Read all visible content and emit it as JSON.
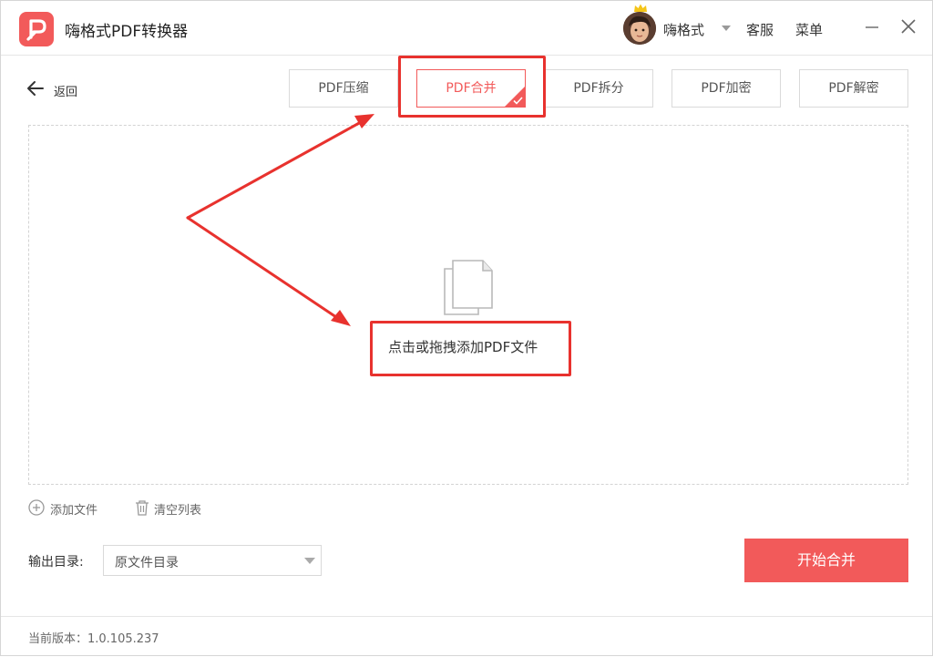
{
  "app": {
    "title": "嗨格式PDF转换器",
    "accent_color": "#f25a5a",
    "logo_icon": "pdf-logo-icon"
  },
  "header": {
    "username": "嗨格式",
    "service_label": "客服",
    "menu_label": "菜单"
  },
  "nav": {
    "back_label": "返回"
  },
  "tabs": [
    {
      "label": "PDF压缩",
      "active": false
    },
    {
      "label": "PDF合并",
      "active": true
    },
    {
      "label": "PDF拆分",
      "active": false
    },
    {
      "label": "PDF加密",
      "active": false
    },
    {
      "label": "PDF解密",
      "active": false
    }
  ],
  "dropzone": {
    "hint": "点击或拖拽添加PDF文件",
    "icon": "documents-icon"
  },
  "actions": {
    "add_file_label": "添加文件",
    "clear_list_label": "清空列表"
  },
  "output": {
    "label": "输出目录:",
    "selected": "原文件目录"
  },
  "start_button_label": "开始合并",
  "footer": {
    "version_text": "当前版本：1.0.105.237"
  },
  "annotation": {
    "color": "#e8322e"
  }
}
